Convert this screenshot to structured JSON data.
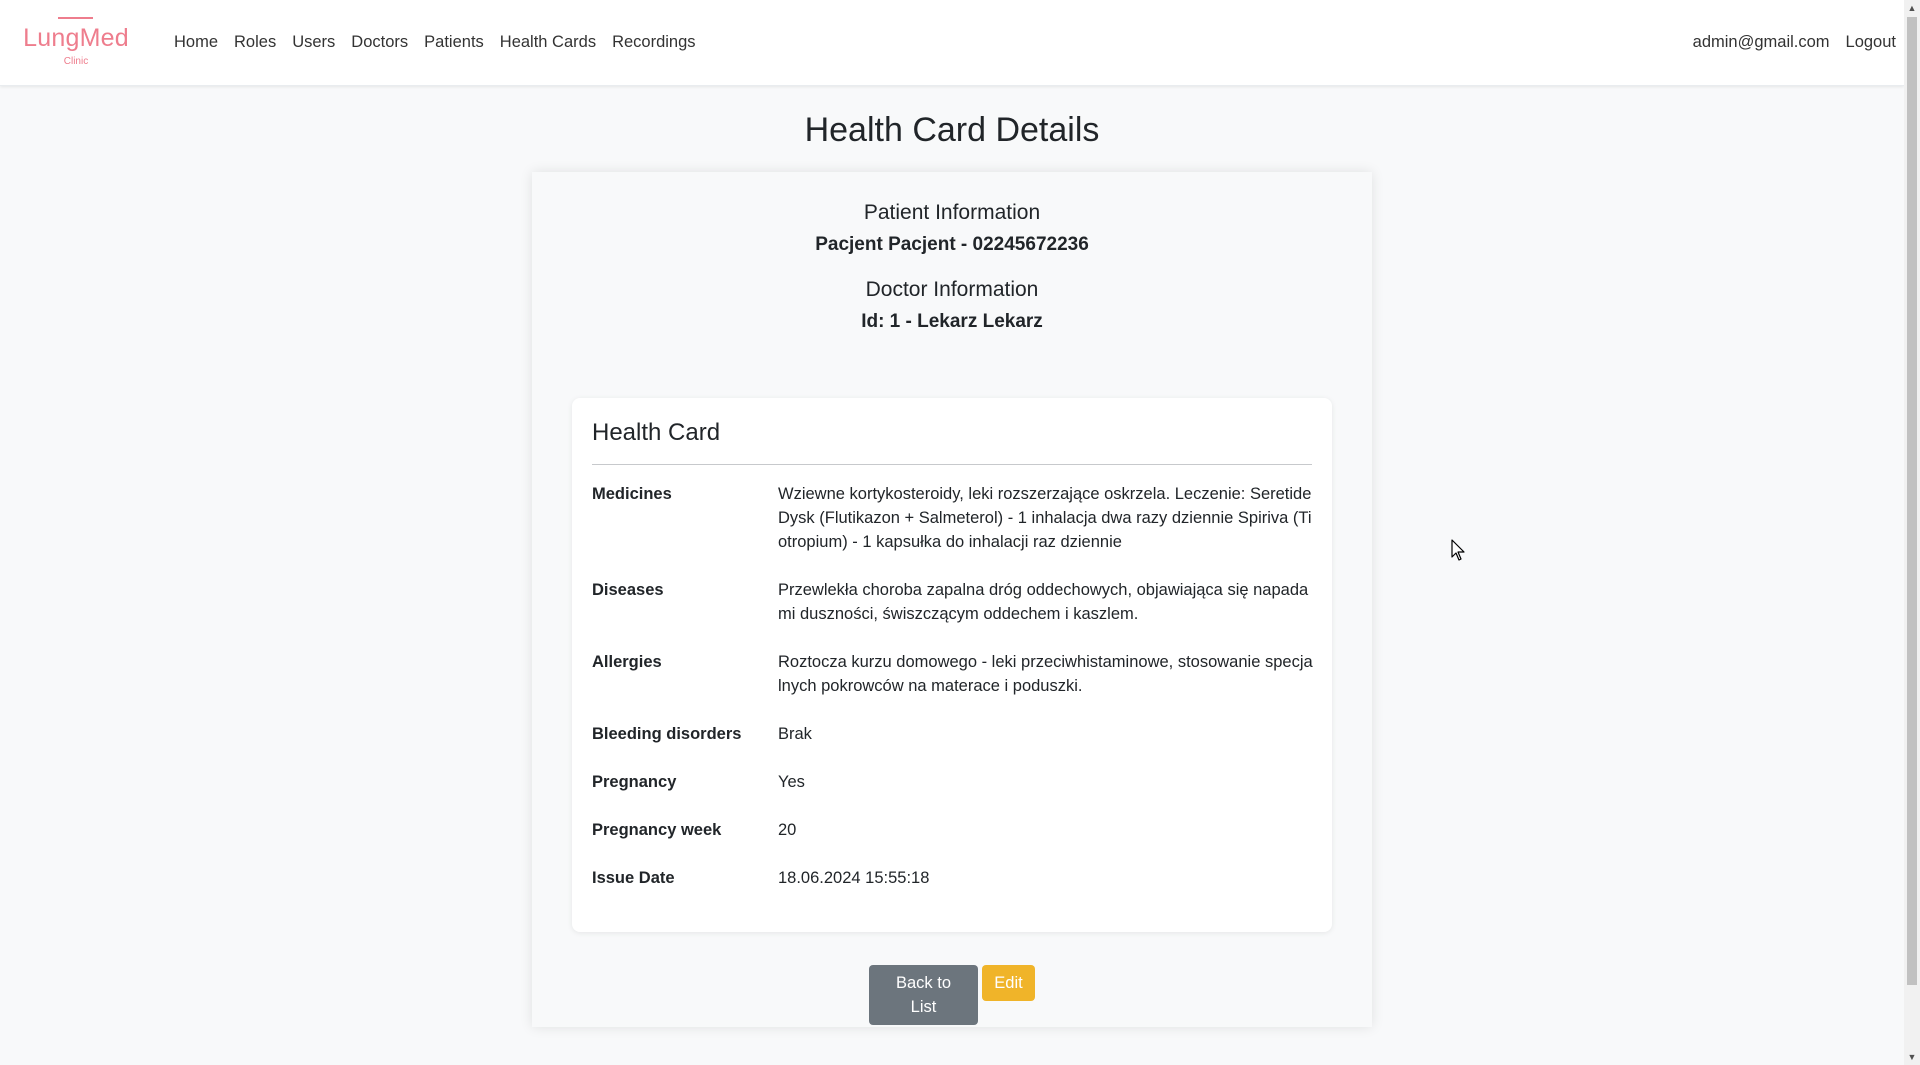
{
  "brand": {
    "name": "LungMed",
    "subtitle": "Clinic",
    "color": "#ee7d8d"
  },
  "nav": {
    "links": [
      "Home",
      "Roles",
      "Users",
      "Doctors",
      "Patients",
      "Health Cards",
      "Recordings"
    ],
    "user_email": "admin@gmail.com",
    "logout_label": "Logout"
  },
  "page": {
    "title": "Health Card Details"
  },
  "patient": {
    "heading": "Patient Information",
    "value": "Pacjent Pacjent - 02245672236"
  },
  "doctor": {
    "heading": "Doctor Information",
    "value": "Id: 1 - Lekarz Lekarz"
  },
  "health_card": {
    "title": "Health Card",
    "rows": [
      {
        "label": "Medicines",
        "value": "Wziewne kortykosteroidy, leki rozszerzające oskrzela. Leczenie: Seretide Dysk (Flutikazon + Salmeterol) - 1 inhalacja dwa razy dziennie Spiriva (Tiotropium) - 1 kapsułka do inhalacji raz dziennie"
      },
      {
        "label": "Diseases",
        "value": "Przewlekła choroba zapalna dróg oddechowych, objawiająca się napadami duszności, świszczącym oddechem i kaszlem."
      },
      {
        "label": "Allergies",
        "value": "Roztocza kurzu domowego - leki przeciwhistaminowe, stosowanie specjalnych pokrowców na materace i poduszki."
      },
      {
        "label": "Bleeding disorders",
        "value": "Brak"
      },
      {
        "label": "Pregnancy",
        "value": "Yes"
      },
      {
        "label": "Pregnancy week",
        "value": "20"
      },
      {
        "label": "Issue Date",
        "value": "18.06.2024 15:55:18"
      }
    ]
  },
  "actions": {
    "back_label": "Back to List",
    "edit_label": "Edit",
    "back_color": "#6c757d",
    "edit_color": "#f0b429"
  }
}
